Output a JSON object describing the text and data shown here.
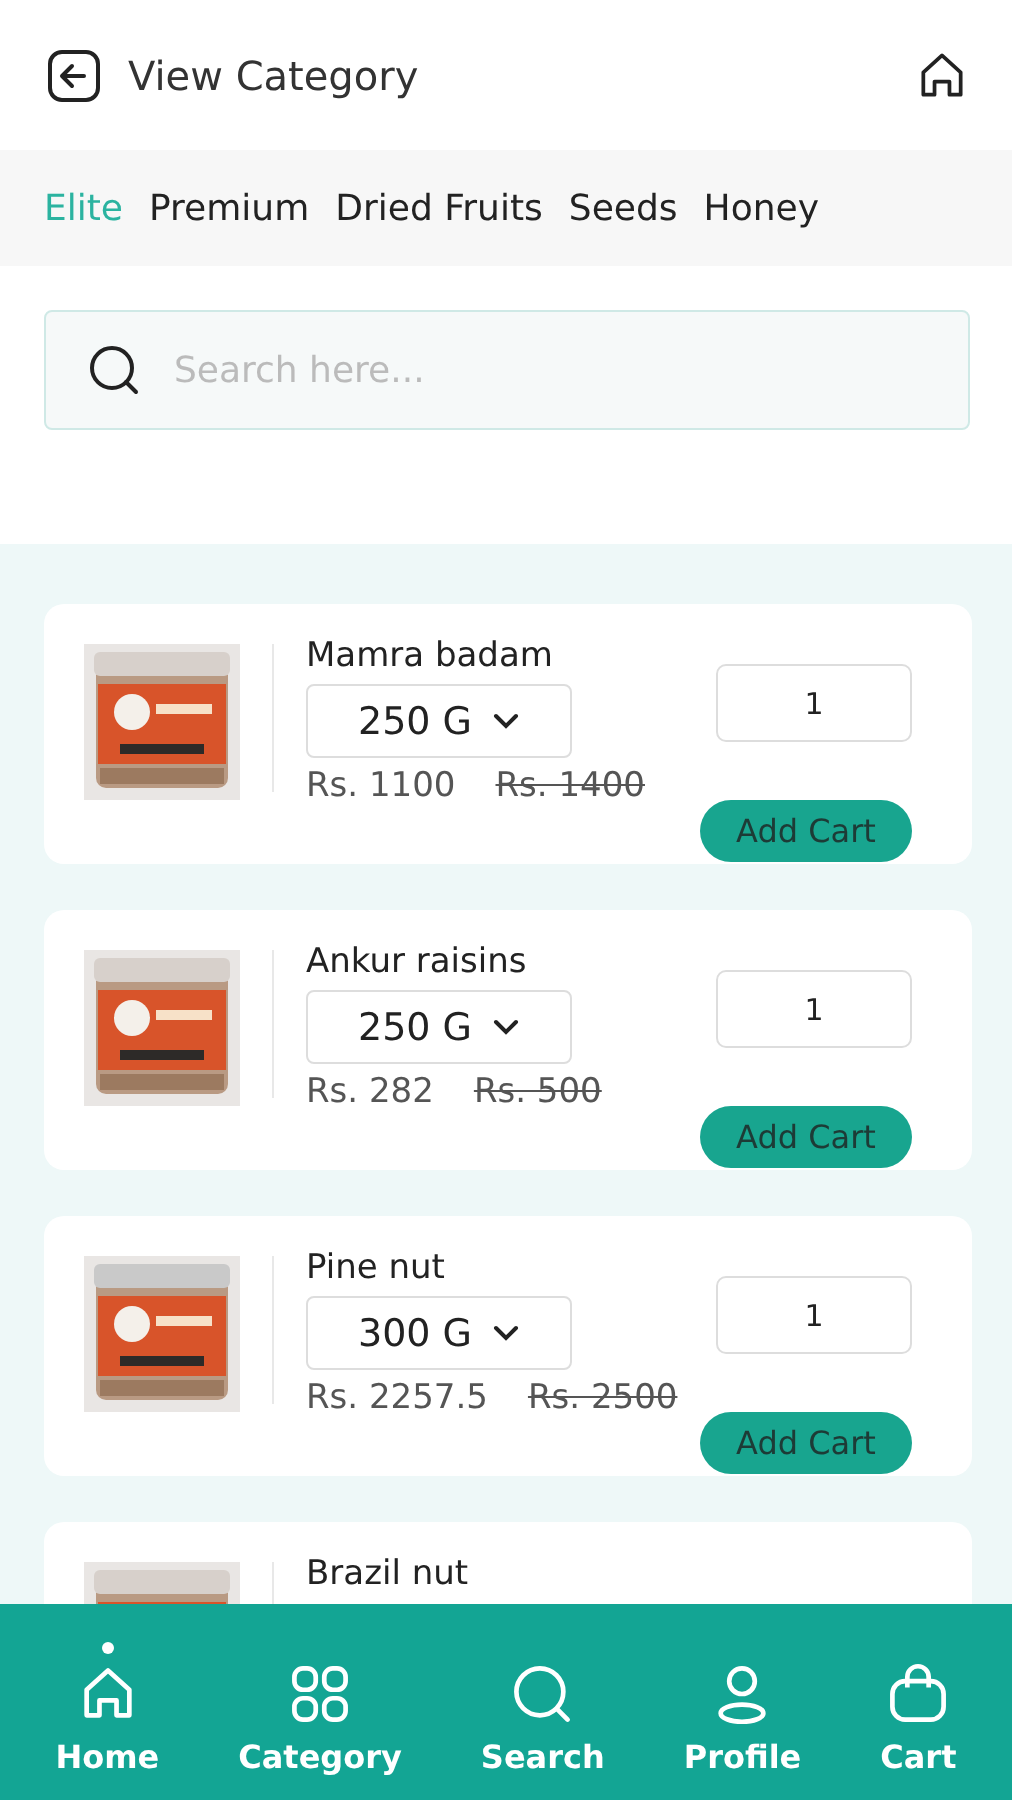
{
  "header": {
    "title": "View Category"
  },
  "tabs": [
    {
      "label": "Elite",
      "selected": true
    },
    {
      "label": "Premium",
      "selected": false
    },
    {
      "label": "Dried Fruits",
      "selected": false
    },
    {
      "label": "Seeds",
      "selected": false
    },
    {
      "label": "Honey",
      "selected": false
    }
  ],
  "search": {
    "placeholder": "Search here..."
  },
  "products": [
    {
      "name": "Mamra badam",
      "size": "250 G",
      "price": "Rs. 1100",
      "old_price": "Rs. 1400",
      "quantity": "1",
      "action": "Add Cart"
    },
    {
      "name": "Ankur raisins",
      "size": "250 G",
      "price": "Rs. 282",
      "old_price": "Rs. 500",
      "quantity": "1",
      "action": "Add Cart"
    },
    {
      "name": "Pine nut",
      "size": "300 G",
      "price": "Rs. 2257.5",
      "old_price": "Rs. 2500",
      "quantity": "1",
      "action": "Add Cart"
    },
    {
      "name": "Brazil nut"
    }
  ],
  "nav": [
    {
      "label": "Home",
      "kind": "home",
      "selected": true
    },
    {
      "label": "Category",
      "kind": "category",
      "selected": false
    },
    {
      "label": "Search",
      "kind": "search",
      "selected": false
    },
    {
      "label": "Profile",
      "kind": "profile",
      "selected": false
    },
    {
      "label": "Cart",
      "kind": "cart",
      "selected": false
    }
  ]
}
